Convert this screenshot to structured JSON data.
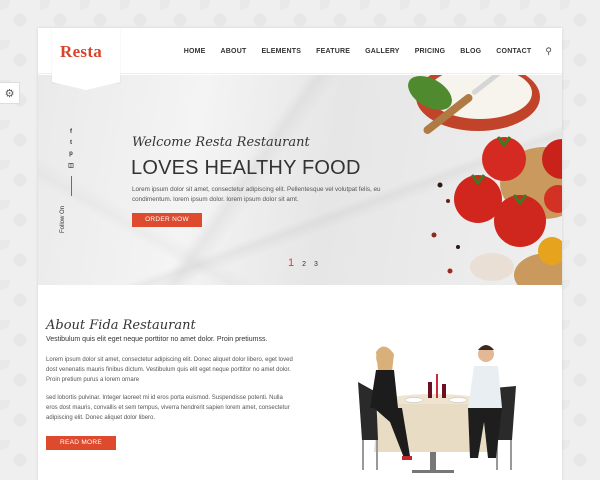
{
  "settings": {
    "icon": "gear-icon"
  },
  "brand": {
    "logo": "Resta",
    "accent": "#d9432b"
  },
  "nav": {
    "items": [
      "HOME",
      "ABOUT",
      "ELEMENTS",
      "FEATURE",
      "GALLERY",
      "PRICING",
      "BLOG",
      "CONTACT"
    ],
    "search_icon": "search-icon"
  },
  "hero": {
    "welcome": "Welcome Resta Restaurant",
    "title": "LOVES HEALTHY FOOD",
    "text": "Lorem ipsum dolor sit amet, consectetur adipiscing elit. Pellentesque vel volutpat felis, eu condimentum. lorem ipsum dolor. lorem ipsum dolor sit amt.",
    "button": "ORDER NOW",
    "follow": "Follow On",
    "social_icons": [
      "facebook-icon",
      "twitter-icon",
      "pinterest-icon",
      "instagram-icon"
    ],
    "pager": [
      "1",
      "2",
      "3"
    ],
    "active_page": "1"
  },
  "about": {
    "title": "About Fida Restaurant",
    "lead": "Vestibulum quis elit eget neque porttitor no amet dolor. Proin pretiumss.",
    "para1": "Lorem ipsum dolor sit amet, consectetur adipiscing elit. Donec aliquet dolor libero, eget loved dost venenatis mauris finibus dictum. Vestibulum quis elit eget neque porttitor no amet dolor. Proin pretium purus a lorem ornare",
    "para2": "sed lobortis pulvinar. Integer laoreet mi id eros porta euismod. Suspendisse potenti. Nulla eros dost mauris, convallis et sem tempus, viverra hendrerit sapien lorem amet, consectetur adipiscing elit. Donec aliquet dolor libero.",
    "button": "READ MORE"
  }
}
